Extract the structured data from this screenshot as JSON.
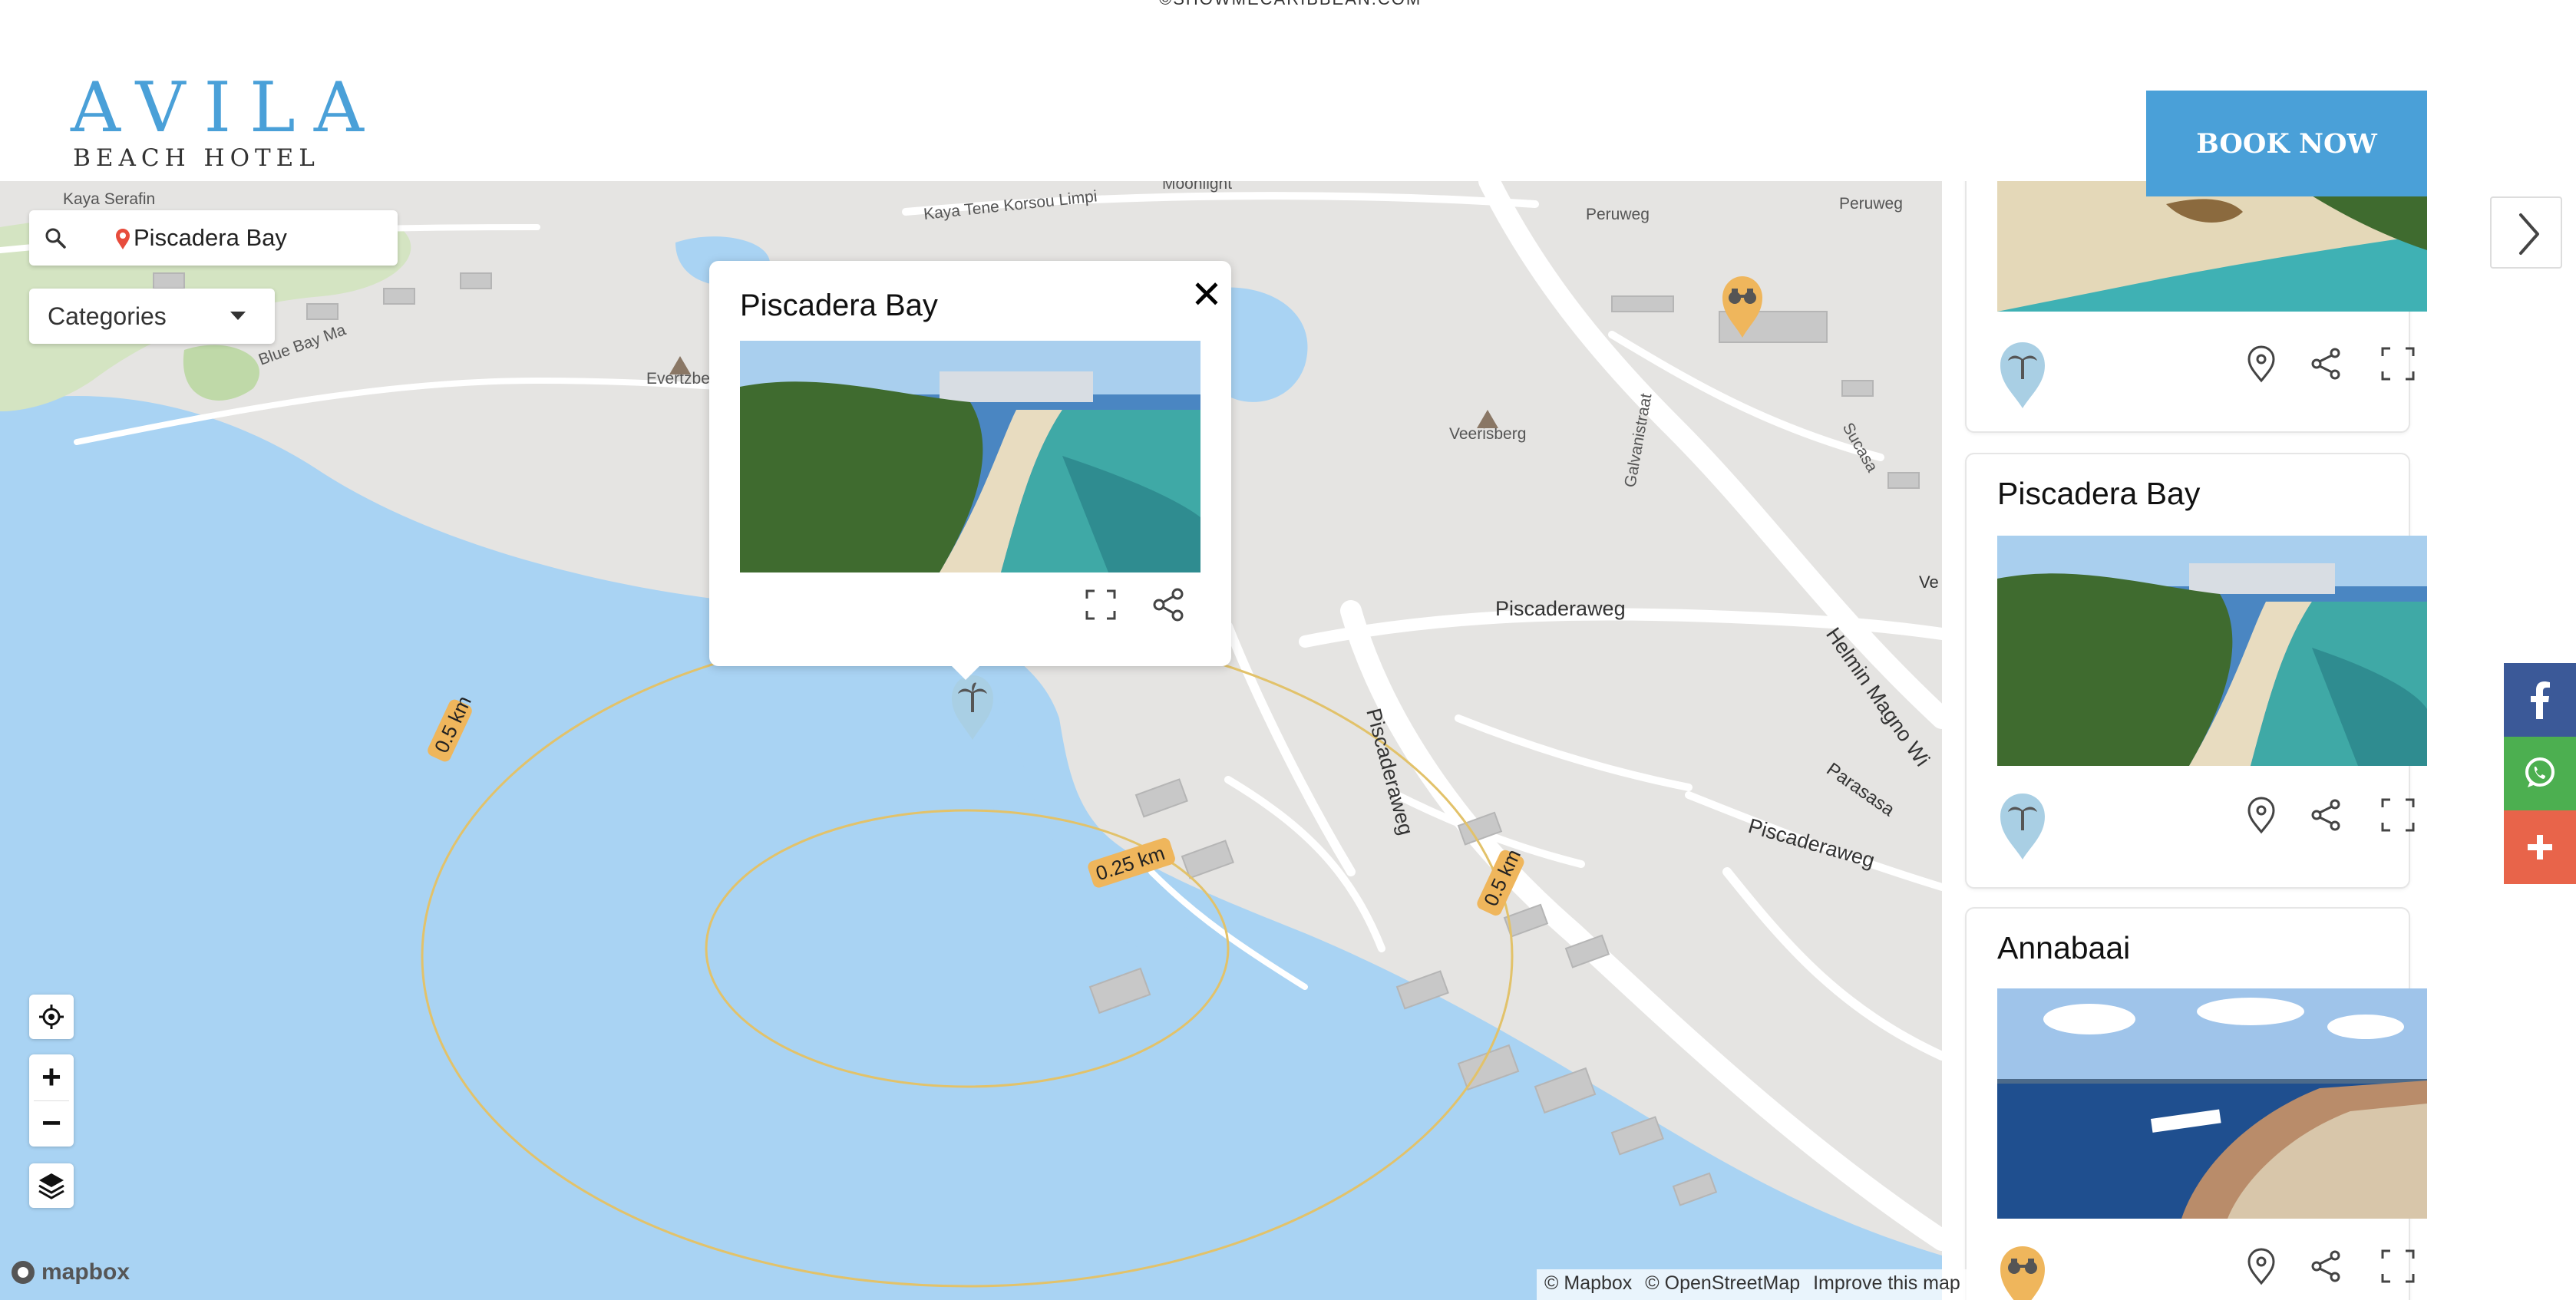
{
  "top_credit": "©SHOWMECARIBBEAN.COM",
  "header": {
    "logo_main": "AVILA",
    "logo_sub": "BEACH HOTEL",
    "book_now_label": "BOOK NOW"
  },
  "map": {
    "search_value": "Piscadera Bay",
    "categories_label": "Categories",
    "zoom_in": "+",
    "zoom_out": "−",
    "street_labels": [
      "Kaya Serafin",
      "Kaya Tene Korsou Limpi",
      "Moonlight",
      "Peruweg",
      "Peruweg",
      "Blue Bay Ma",
      "Evertzberg",
      "Veerisberg",
      "Galvanistraat",
      "Sucasa",
      "Piscaderaweg",
      "Piscaderaweg",
      "Piscaderaweg",
      "Helmin Magno Wi",
      "Parasasa",
      "Ve"
    ],
    "distance_labels": [
      "0.5 km",
      "0.25 km",
      "0.5 km"
    ],
    "mapbox_label": "mapbox",
    "attribution": [
      "© Mapbox",
      "© OpenStreetMap",
      "Improve this map"
    ]
  },
  "popup": {
    "title": "Piscadera Bay",
    "close_label": "✕"
  },
  "sidebar": {
    "cards": [
      {
        "title": "",
        "category": "beach"
      },
      {
        "title": "Piscadera Bay",
        "category": "beach"
      },
      {
        "title": "Annabaai",
        "category": "sightseeing"
      }
    ]
  },
  "colors": {
    "brand_blue": "#4aa0d8",
    "water": "#a9d3f3",
    "land": "#e5e4e2",
    "marker_blue": "#a9cfe4",
    "marker_orange": "#efb65c",
    "facebook": "#3b5998",
    "whatsapp": "#4caf50",
    "share_more": "#e8644a"
  },
  "icons": {
    "search": "search-icon",
    "pin": "pin-icon",
    "locate": "locate-icon",
    "layers": "layers-icon",
    "expand": "expand-icon",
    "share": "share-icon",
    "map_pin": "map-pin-icon",
    "palm": "palm-tree-icon",
    "binoculars": "binoculars-icon",
    "chevron": "chevron-right-icon",
    "facebook": "facebook-icon",
    "whatsapp": "whatsapp-icon",
    "plus": "plus-icon"
  }
}
